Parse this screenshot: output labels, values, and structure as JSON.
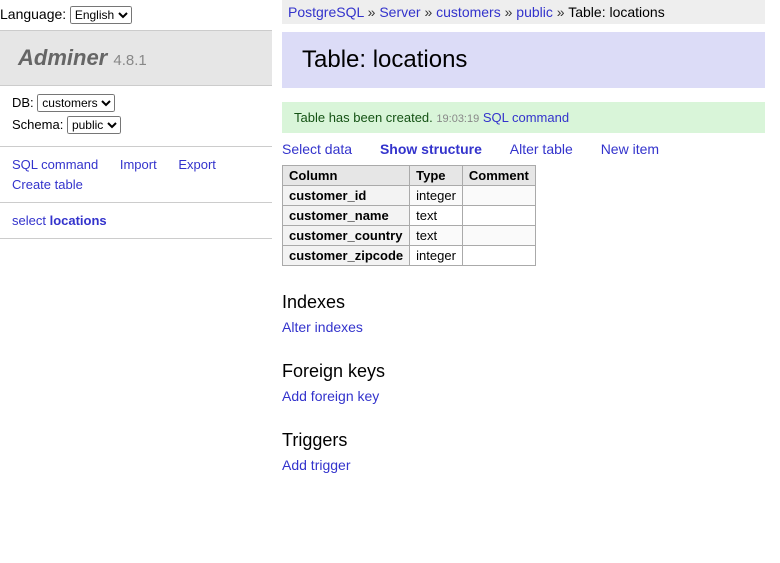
{
  "lang_label": "Language:",
  "lang_value": "English",
  "app_name": "Adminer",
  "app_version": "4.8.1",
  "db_label": "DB:",
  "db_value": "customers",
  "schema_label": "Schema:",
  "schema_value": "public",
  "sidebar_links": {
    "sql": "SQL command",
    "import": "Import",
    "export": "Export",
    "create": "Create table"
  },
  "table_entry": {
    "prefix": "select ",
    "name": "locations"
  },
  "breadcrumb": {
    "pg": "PostgreSQL",
    "server": "Server",
    "db": "customers",
    "schema": "public",
    "tail": "Table: locations"
  },
  "title": "Table: locations",
  "message": {
    "text": "Table has been created.",
    "timestamp": "19:03:19",
    "link": "SQL command"
  },
  "tabs": {
    "select": "Select data",
    "structure": "Show structure",
    "alter": "Alter table",
    "newitem": "New item"
  },
  "columns_header": {
    "col": "Column",
    "type": "Type",
    "comment": "Comment"
  },
  "columns": [
    {
      "name": "customer_id",
      "type": "integer",
      "comment": ""
    },
    {
      "name": "customer_name",
      "type": "text",
      "comment": ""
    },
    {
      "name": "customer_country",
      "type": "text",
      "comment": ""
    },
    {
      "name": "customer_zipcode",
      "type": "integer",
      "comment": ""
    }
  ],
  "sections": {
    "indexes": {
      "title": "Indexes",
      "link": "Alter indexes"
    },
    "fks": {
      "title": "Foreign keys",
      "link": "Add foreign key"
    },
    "triggers": {
      "title": "Triggers",
      "link": "Add trigger"
    }
  }
}
